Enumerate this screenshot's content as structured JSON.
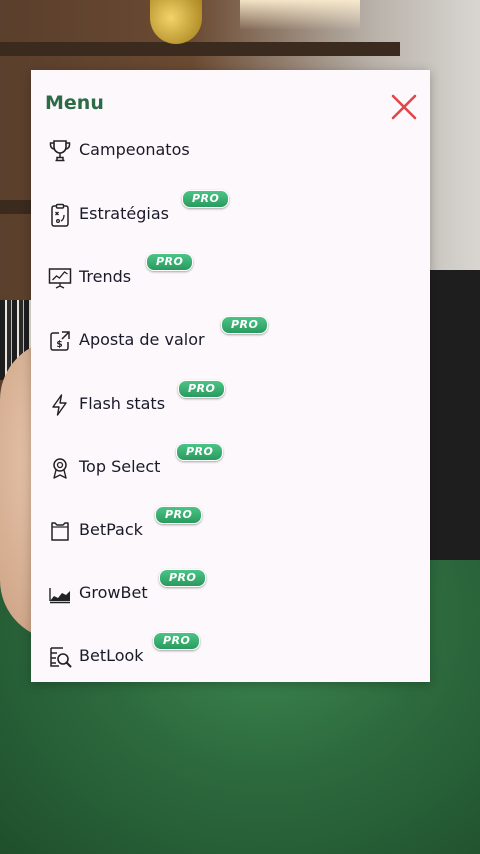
{
  "menu": {
    "title": "Menu",
    "close_icon": "close-icon",
    "accent_color": "#2c6a48",
    "close_color": "#e0464a",
    "badge_color": "#34b06f",
    "items": [
      {
        "label": "Campeonatos",
        "icon": "trophy-icon",
        "badge": ""
      },
      {
        "label": "Estratégias",
        "icon": "clipboard-strategy-icon",
        "badge": "PRO"
      },
      {
        "label": "Trends",
        "icon": "chart-presentation-icon",
        "badge": "PRO"
      },
      {
        "label": "Aposta de valor",
        "icon": "money-link-icon",
        "badge": "PRO"
      },
      {
        "label": "Flash stats",
        "icon": "lightning-icon",
        "badge": "PRO"
      },
      {
        "label": "Top Select",
        "icon": "award-icon",
        "badge": "PRO"
      },
      {
        "label": "BetPack",
        "icon": "package-icon",
        "badge": "PRO"
      },
      {
        "label": "GrowBet",
        "icon": "area-chart-icon",
        "badge": "PRO"
      },
      {
        "label": "BetLook",
        "icon": "search-document-icon",
        "badge": "PRO"
      }
    ]
  }
}
